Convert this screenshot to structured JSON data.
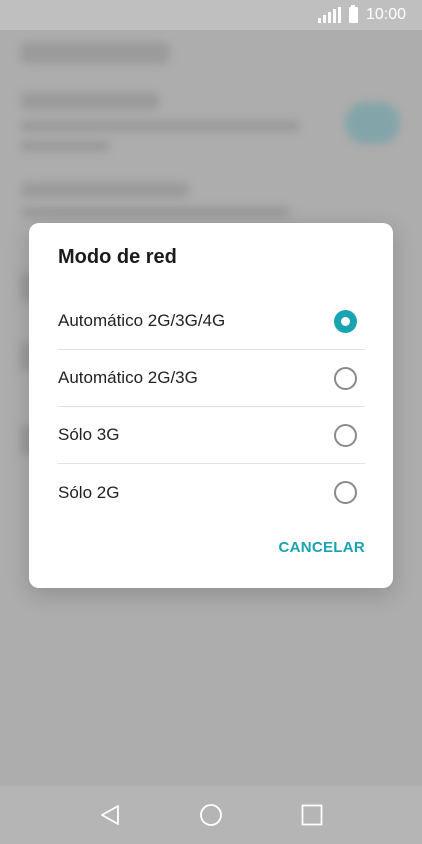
{
  "status_bar": {
    "time": "10:00",
    "signal_icon": "signal-icon",
    "battery_icon": "battery-icon"
  },
  "dialog": {
    "title": "Modo de red",
    "options": [
      {
        "label": "Automático 2G/3G/4G",
        "selected": true
      },
      {
        "label": "Automático 2G/3G",
        "selected": false
      },
      {
        "label": "Sólo 3G",
        "selected": false
      },
      {
        "label": "Sólo 2G",
        "selected": false
      }
    ],
    "cancel_label": "CANCELAR"
  },
  "nav_bar": {
    "back_icon": "back-icon",
    "home_icon": "home-icon",
    "recents_icon": "recents-icon"
  },
  "colors": {
    "accent": "#1aa3b0",
    "scrim": "#bdbdbd"
  }
}
